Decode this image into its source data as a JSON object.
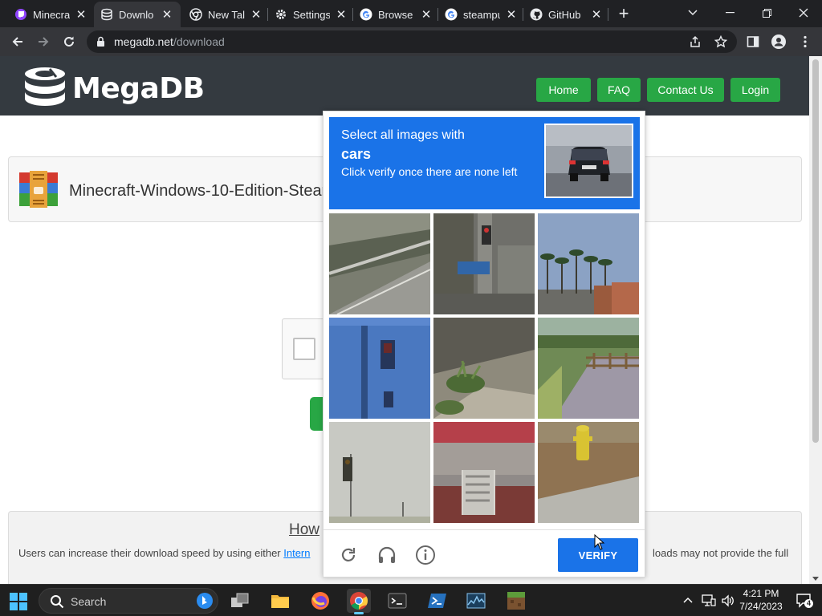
{
  "browser": {
    "tabs": [
      {
        "title": "Minecra",
        "icon": "twitch-icon",
        "active": false
      },
      {
        "title": "Downlo",
        "icon": "megadb-icon",
        "active": true
      },
      {
        "title": "New Tal",
        "icon": "chrome-icon",
        "active": false
      },
      {
        "title": "Settings",
        "icon": "settings-gear-icon",
        "active": false
      },
      {
        "title": "Browse",
        "icon": "google-icon",
        "active": false
      },
      {
        "title": "steampu",
        "icon": "google-icon",
        "active": false
      },
      {
        "title": "GitHub",
        "icon": "github-icon",
        "active": false
      }
    ],
    "new_tab_label": "+",
    "url_domain": "megadb.net",
    "url_path": "/download"
  },
  "site": {
    "logo_text": "MegaDB",
    "nav": [
      "Home",
      "FAQ",
      "Contact Us",
      "Login"
    ],
    "file_name": "Minecraft-Windows-10-Edition-SteamP",
    "info_heading": "How",
    "info_left": "Users can increase their download speed by using either ",
    "info_link": "Intern",
    "info_right": "loads may not provide the full"
  },
  "captcha": {
    "instruction_1": "Select all images with",
    "target": "cars",
    "instruction_2": "Click verify once there are none left",
    "verify_label": "VERIFY",
    "tiles": [
      {
        "subject": "road-guardrail"
      },
      {
        "subject": "street-sign-pole"
      },
      {
        "subject": "palm-trees"
      },
      {
        "subject": "traffic-light-blue-sky"
      },
      {
        "subject": "shrubs-sidewalk"
      },
      {
        "subject": "fenced-path"
      },
      {
        "subject": "traffic-light-haze"
      },
      {
        "subject": "building-stairs"
      },
      {
        "subject": "fire-hydrant"
      }
    ]
  },
  "taskbar": {
    "search_label": "Search",
    "clock_time": "4:21 PM",
    "clock_date": "7/24/2023",
    "notification_count": "4"
  },
  "colors": {
    "site_header": "#343a40",
    "brand_green": "#28a745",
    "captcha_blue": "#1a73e8"
  }
}
